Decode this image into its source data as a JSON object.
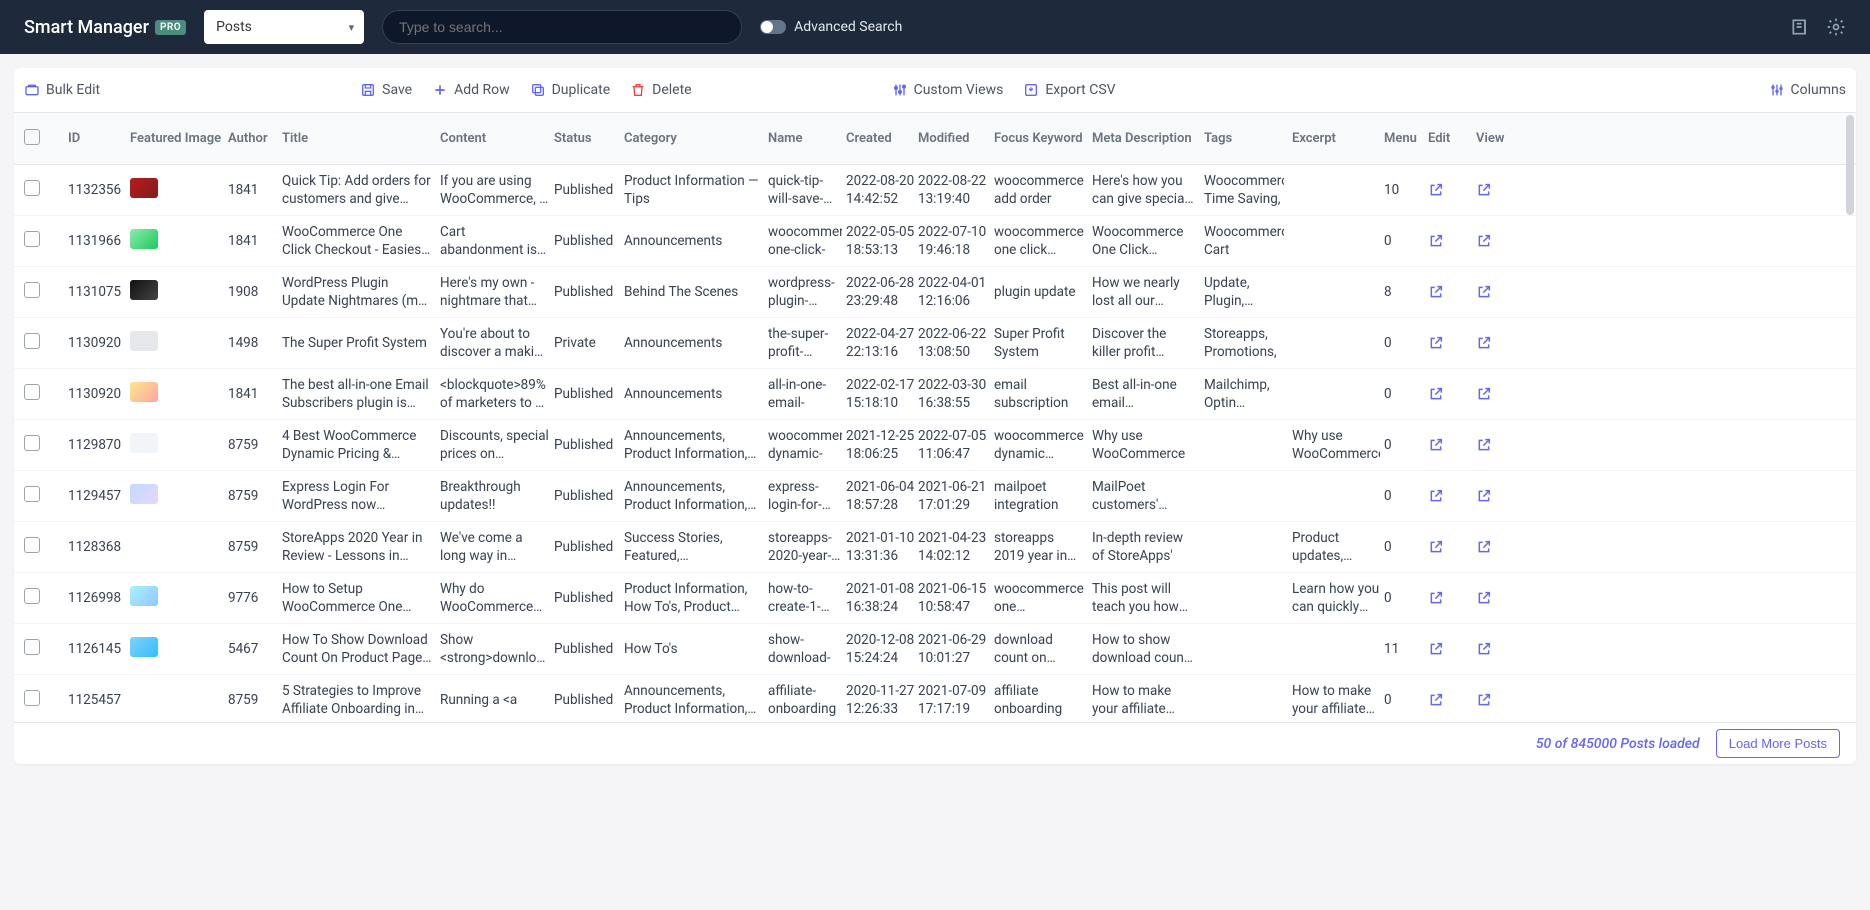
{
  "topbar": {
    "brand": "Smart Manager",
    "pro": "PRO",
    "select_value": "Posts",
    "search_placeholder": "Type to search...",
    "advanced_search": "Advanced Search"
  },
  "toolbar": {
    "bulk_edit": "Bulk Edit",
    "save": "Save",
    "add_row": "Add Row",
    "duplicate": "Duplicate",
    "delete": "Delete",
    "custom_views": "Custom Views",
    "export_csv": "Export CSV",
    "columns": "Columns"
  },
  "headers": {
    "id": "ID",
    "featured_image": "Featured Image",
    "author": "Author",
    "title": "Title",
    "content": "Content",
    "status": "Status",
    "category": "Category",
    "name": "Name",
    "created": "Created",
    "modified": "Modified",
    "focus_keyword": "Focus Keyword",
    "meta_description": "Meta Description",
    "tags": "Tags",
    "excerpt": "Excerpt",
    "menu": "Menu",
    "edit": "Edit",
    "view": "View"
  },
  "rows": [
    {
      "id": "1132356",
      "thumb": "thumb-a",
      "author": "1841",
      "title": "Quick Tip: Add orders for customers and give them an",
      "content": "If you are using WooCommerce, a handy solution for all the",
      "status": "Published",
      "category": "Product Information — Tips",
      "name": "quick-tip-will-save-time-pile-",
      "created": "2022-08-20 14:42:52",
      "modified": "2022-08-22 13:19:40",
      "focus": "woocommerce add order",
      "meta": "Here's how you can give special pricing /",
      "tags": "Woocommerce, Time Saving,",
      "excerpt": "",
      "menu": "10"
    },
    {
      "id": "1131966",
      "thumb": "thumb-b",
      "author": "1841",
      "title": "WooCommerce One Click Checkout - Easiest & Quickest",
      "content": "Cart abandonment is probably you face as a online retailer",
      "status": "Published",
      "category": "Announcements",
      "name": "woocommerce-one-click-",
      "created": "2022-05-05 18:53:13",
      "modified": "2022-07-10 19:46:18",
      "focus": "woocommerce one click checkout",
      "meta": "Woocommerce One Click Checkout plugin",
      "tags": "Woocommerce, Cart",
      "excerpt": "",
      "menu": "0"
    },
    {
      "id": "1131075",
      "thumb": "thumb-c",
      "author": "1908",
      "title": "WordPress Plugin Update Nightmares (my own story) and",
      "content": "Here's my own - nightmare that included some guidelines",
      "status": "Published",
      "category": "Behind The Scenes",
      "name": "wordpress-plugin-update-",
      "created": "2022-06-28 23:29:48",
      "modified": "2022-04-01 12:16:06",
      "focus": "plugin update",
      "meta": "How we nearly lost all our business due to",
      "tags": "Update, Plugin, Solution, Fail",
      "excerpt": "",
      "menu": "8"
    },
    {
      "id": "1130920",
      "thumb": "thumb-d",
      "author": "1498",
      "title": "The Super Profit System",
      "content": "You're about to discover a making tactic used by to",
      "status": "Private",
      "category": "Announcements",
      "name": "the-super-profit-system",
      "created": "2022-04-27 22:13:16",
      "modified": "2022-06-22 13:08:50",
      "focus": "Super Profit System",
      "meta": "Discover the killer profit making tactic",
      "tags": "Storeapps, Promotions,",
      "excerpt": "",
      "menu": "0"
    },
    {
      "id": "1130920",
      "thumb": "thumb-e",
      "author": "1841",
      "title": "The best all-in-one Email Subscribers plugin is here",
      "content": "<blockquote>89% of marketers to be their top lead gene",
      "status": "Published",
      "category": "Announcements",
      "name": "all-in-one-email-",
      "created": "2022-02-17 15:18:10",
      "modified": "2022-03-30 16:38:55",
      "focus": "email subscription",
      "meta": "Best all-in-one email subscription plugin on",
      "tags": "Mailchimp, Optin Monster,",
      "excerpt": "",
      "menu": "0"
    },
    {
      "id": "1129870",
      "thumb": "thumb-f",
      "author": "8759",
      "title": "4 Best WooCommerce Dynamic Pricing & Discounts",
      "content": "Discounts, special prices on products...proven formulas",
      "status": "Published",
      "category": "Announcements, Product Information, Product",
      "name": "woocommerce-dynamic-",
      "created": "2021-12-25 18:06:25",
      "modified": "2022-07-05 11:06:47",
      "focus": "woocommerce dynamic pricing,woocommerce",
      "meta": "Why use WooCommerce",
      "tags": "",
      "excerpt": "Why use WooCommerce",
      "menu": "0"
    },
    {
      "id": "1129457",
      "thumb": "thumb-g",
      "author": "8759",
      "title": "Express Login For WordPress now Integrates with MailPoet",
      "content": "Breakthrough updates!!",
      "status": "Published",
      "category": "Announcements, Product Information, Product",
      "name": "express-login-for-wordpress-",
      "created": "2021-06-04 18:57:28",
      "modified": "2021-06-21 17:01:29",
      "focus": "mailpoet integration",
      "meta": "MailPoet customers' customers can now",
      "tags": "",
      "excerpt": "",
      "menu": "0"
    },
    {
      "id": "1128368",
      "thumb": "thumb-h",
      "author": "8759",
      "title": "StoreApps 2020 Year in Review - Lessons in WooCommerce",
      "content": "We've come a long way in product improvements, t",
      "status": "Published",
      "category": "Success Stories, Featured, Recommended Readings",
      "name": "storeapps-2020-year-in-",
      "created": "2021-01-10 13:31:36",
      "modified": "2021-04-23 14:02:12",
      "focus": "storeapps 2019 year in review",
      "meta": "In-depth review of StoreApps'",
      "tags": "",
      "excerpt": "Product updates, marketing",
      "menu": "0"
    },
    {
      "id": "1126998",
      "thumb": "thumb-i",
      "author": "9776",
      "title": "How to Setup WooCommerce One Click Upsell Offer Funnel?",
      "content": "Why do WooCommerce upsell BOGO and other offers a",
      "status": "Published",
      "category": "Product Information, How To's, Product Information —",
      "name": "how-to-create-1-click-upsells-",
      "created": "2021-01-08 16:38:24",
      "modified": "2021-06-15 10:58:47",
      "focus": "woocommerce one upsell,woocommerce",
      "meta": "This post will teach you how you can",
      "tags": "",
      "excerpt": "Learn how you can quickly create and",
      "menu": "0"
    },
    {
      "id": "1126145",
      "thumb": "thumb-j",
      "author": "5467",
      "title": "How To Show Download Count On Product Page In",
      "content": "Show <strong>download Page</strong> of your st",
      "status": "Published",
      "category": "How To's",
      "name": "show-download-",
      "created": "2020-12-08 15:24:24",
      "modified": "2021-06-29 10:01:27",
      "focus": "download count on woocommerce",
      "meta": "How to show download count on",
      "tags": "",
      "excerpt": "",
      "menu": "11"
    },
    {
      "id": "1125457",
      "thumb": "thumb-k",
      "author": "8759",
      "title": "5 Strategies to Improve Affiliate Onboarding in WooCommerce",
      "content": "Running a <a",
      "status": "Published",
      "category": "Announcements, Product Information, Recommended",
      "name": "affiliate-onboarding",
      "created": "2020-11-27 12:26:33",
      "modified": "2021-07-09 17:17:19",
      "focus": "affiliate onboarding",
      "meta": "How to make your affiliate onboarding",
      "tags": "",
      "excerpt": "How to make your affiliate onboarding",
      "menu": "0"
    }
  ],
  "footer": {
    "status": "50 of 845000 Posts loaded",
    "load_more": "Load More Posts"
  }
}
